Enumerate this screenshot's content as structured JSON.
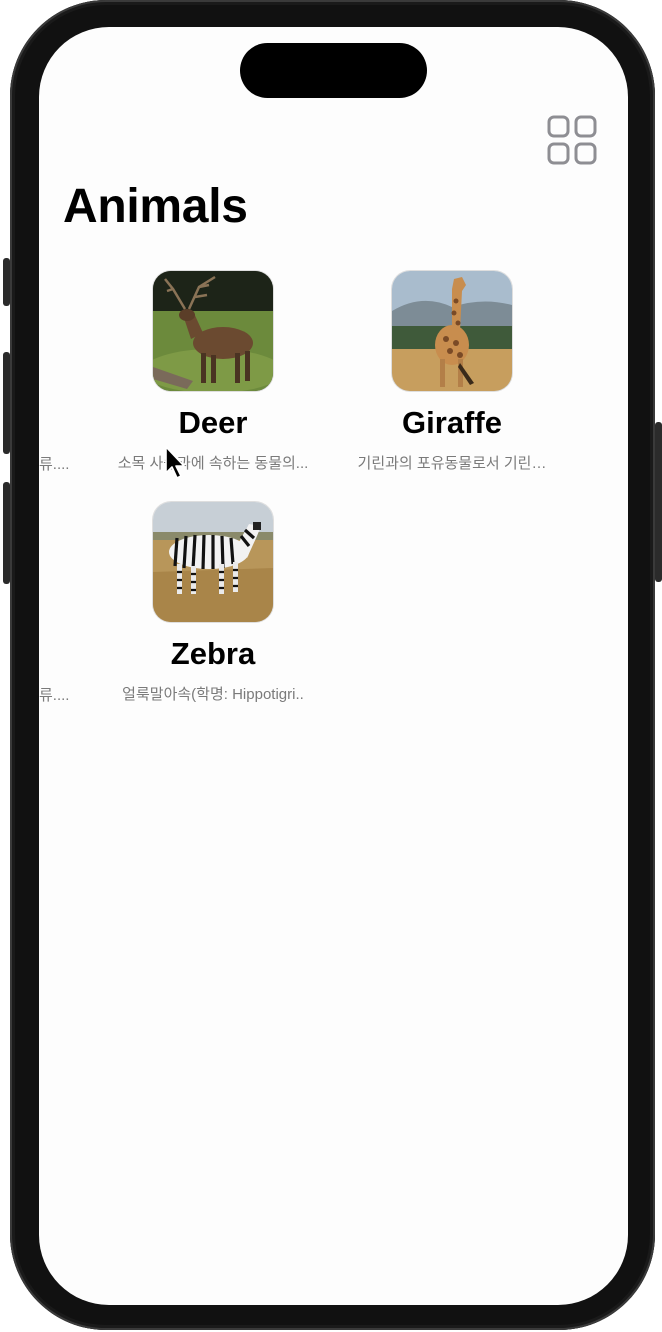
{
  "nav": {
    "title": "Animals",
    "layout_toggle_icon": "grid-2x2-icon"
  },
  "animals": [
    {
      "name": "Deer",
      "description": "소목 사슴과에 속하는 동물의...",
      "image": "deer-photo"
    },
    {
      "name": "Giraffe",
      "description": "기린과의 포유동물로서 기린…",
      "image": "giraffe-photo"
    },
    {
      "name": "Zebra",
      "description": "얼룩말아속(학명: Hippotigri..",
      "image": "zebra-photo"
    }
  ],
  "offscreen_column": {
    "row1_text": "류....",
    "row2_text": "류...."
  },
  "colors": {
    "background": "#fdfdfd",
    "secondary_text": "#7a7a7a",
    "icon_gray": "#8e8e93"
  }
}
